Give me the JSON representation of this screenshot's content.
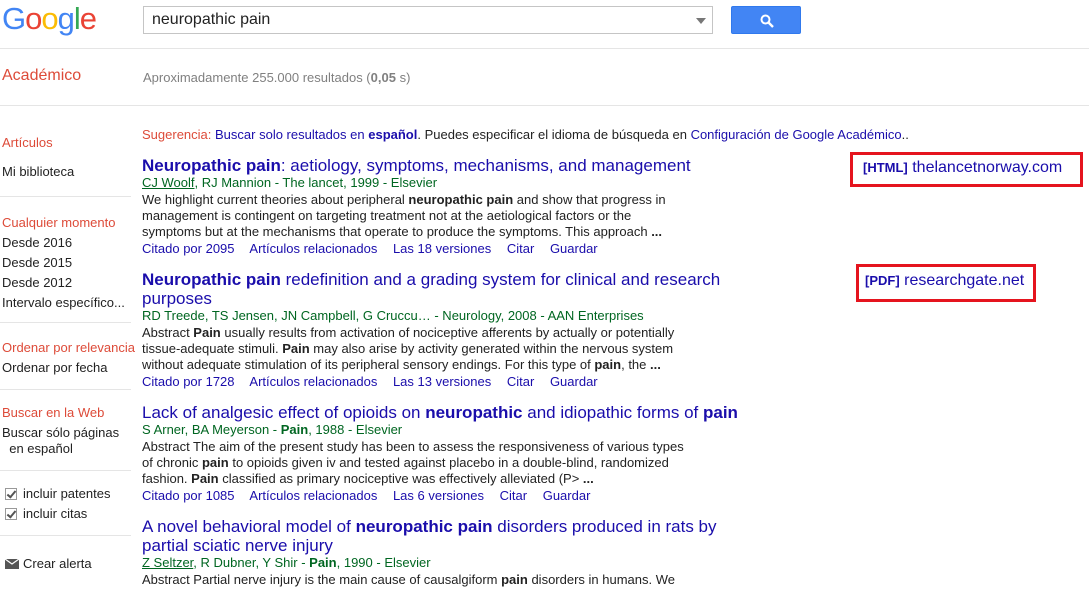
{
  "header": {
    "logo_letters": [
      {
        "ch": "G",
        "color": "#4285f4"
      },
      {
        "ch": "o",
        "color": "#ea4335"
      },
      {
        "ch": "o",
        "color": "#fbbc05"
      },
      {
        "ch": "g",
        "color": "#4285f4"
      },
      {
        "ch": "l",
        "color": "#34a853"
      },
      {
        "ch": "e",
        "color": "#ea4335"
      }
    ],
    "search_value": "neuropathic pain",
    "section_title": "Académico",
    "results_count_prefix": "Aproximadamente 255.000 resultados (",
    "results_count_time": "0,05",
    "results_count_suffix": " s)"
  },
  "sidebar": {
    "articles": "Artículos",
    "my_library": "Mi biblioteca",
    "any_time": "Cualquier momento",
    "since_2016": "Desde 2016",
    "since_2015": "Desde 2015",
    "since_2012": "Desde 2012",
    "specific_range": "Intervalo específico...",
    "sort_relevance": "Ordenar por relevancia",
    "sort_date": "Ordenar por fecha",
    "search_web": "Buscar en la Web",
    "search_spanish_1": "Buscar sólo páginas",
    "search_spanish_2": "en español",
    "include_patents": "incluir patentes",
    "include_citations": "incluir citas",
    "create_alert": "Crear alerta"
  },
  "suggestion": {
    "label": "Sugerencia:",
    "link1": "Buscar solo resultados en",
    "link1_bold": "español",
    "middle": ". Puedes especificar el idioma de búsqueda en",
    "link2": "Configuración de Google Académico",
    "end": ".."
  },
  "results": [
    {
      "title_bold": "Neuropathic pain",
      "title_rest": ": aetiology, symptoms, mechanisms, and management",
      "author_link": "CJ Woolf",
      "authors_rest": ", RJ Mannion - The lancet, 1999 - Elsevier",
      "snippet": "We highlight current theories about peripheral neuropathic pain and show that progress in management is contingent on targeting treatment not at the aetiological factors or the symptoms but at the mechanisms that operate to produce the symptoms. This approach ...",
      "cited": "Citado por 2095",
      "related": "Artículos relacionados",
      "versions": "Las 18 versiones",
      "cite": "Citar",
      "save": "Guardar",
      "side_tag": "[HTML]",
      "side_domain": "thelancetnorway.com"
    },
    {
      "title_bold": "Neuropathic pain",
      "title_rest": " redefinition and a grading system for clinical and research purposes",
      "author_link": "",
      "authors_rest": "RD Treede, TS Jensen, JN Campbell, G Cruccu… - Neurology, 2008 - AAN Enterprises",
      "cited": "Citado por 1728",
      "related": "Artículos relacionados",
      "versions": "Las 13 versiones",
      "cite": "Citar",
      "save": "Guardar",
      "side_tag": "[PDF]",
      "side_domain": "researchgate.net"
    },
    {
      "title_pre": "Lack of analgesic effect of opioids on ",
      "title_bold": "neuropathic",
      "title_mid": " and idiopathic forms of ",
      "title_bold2": "pain",
      "authors_rest": "S Arner, BA Meyerson - Pain, 1988 - Elsevier",
      "cited": "Citado por 1085",
      "related": "Artículos relacionados",
      "versions": "Las 6 versiones",
      "cite": "Citar",
      "save": "Guardar"
    },
    {
      "title_pre": "A novel behavioral model of ",
      "title_bold": "neuropathic pain",
      "title_rest": " disorders produced in rats by partial sciatic nerve injury",
      "author_link": "Z Seltzer",
      "authors_rest": ", R Dubner, Y Shir - Pain, 1990 - Elsevier"
    }
  ]
}
